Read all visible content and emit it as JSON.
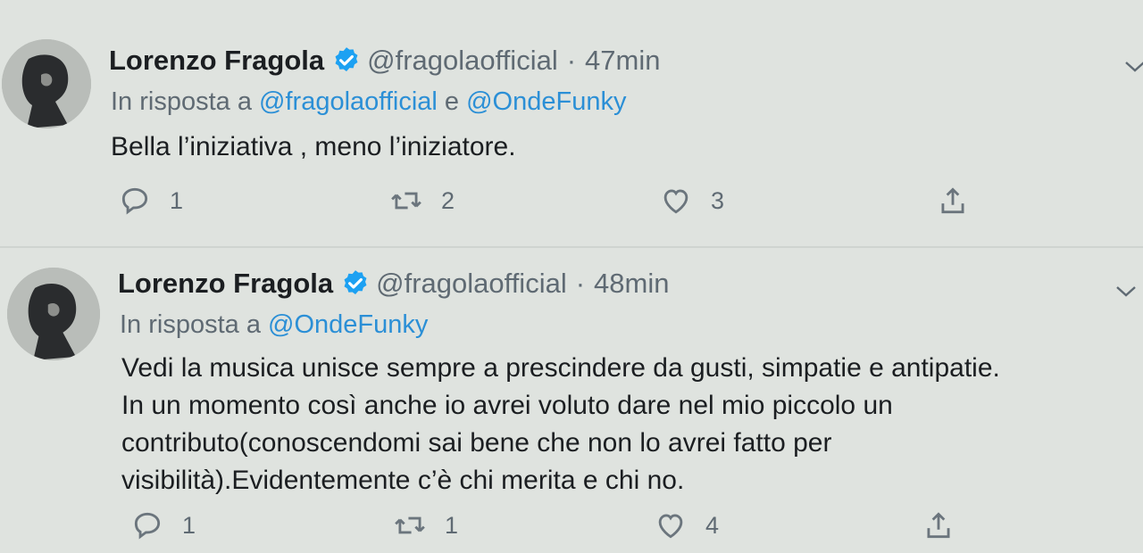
{
  "tweets": [
    {
      "author": "Lorenzo Fragola",
      "handle": "@fragolaofficial",
      "separator": "·",
      "time": "47min",
      "reply_prefix": "In risposta a",
      "reply_mention_1": "@fragolaofficial",
      "reply_joiner": "e",
      "reply_mention_2": "@OndeFunky",
      "text_lines": [
        "Bella l’iniziativa , meno l’iniziatore."
      ],
      "replies": "1",
      "retweets": "2",
      "likes": "3"
    },
    {
      "author": "Lorenzo Fragola",
      "handle": "@fragolaofficial",
      "separator": "·",
      "time": "48min",
      "reply_prefix": "In risposta a",
      "reply_mention_1": "@OndeFunky",
      "text_lines": [
        "Vedi la musica unisce sempre a prescindere da gusti, simpatie e antipatie.",
        "In un momento così anche io avrei voluto dare nel mio piccolo un",
        "contributo(conoscendomi sai bene che non lo avrei fatto per",
        "visibilità).Evidentemente c’è chi merita e chi no."
      ],
      "replies": "1",
      "retweets": "1",
      "likes": "4"
    }
  ],
  "icons": {
    "verified": "verified-badge-icon",
    "reply": "reply-icon",
    "retweet": "retweet-icon",
    "like": "heart-icon",
    "share": "share-icon",
    "more": "chevron-down-icon"
  },
  "colors": {
    "background": "#dfe3df",
    "link": "#2b8fd6",
    "secondary": "#5f6a73",
    "verified": "#1da1f2"
  }
}
